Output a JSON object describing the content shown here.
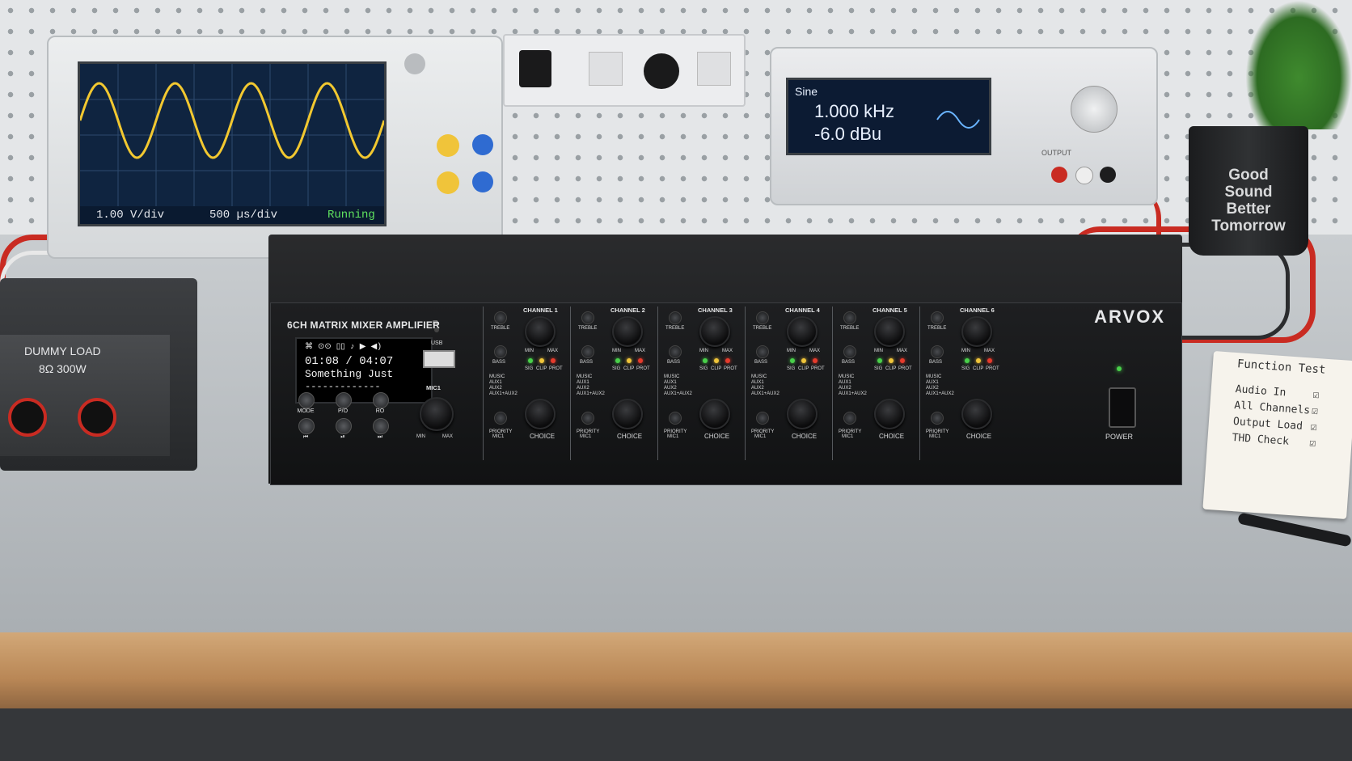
{
  "scope": {
    "volts_div": "1.00 V/div",
    "time_div": "500 µs/div",
    "status": "Running"
  },
  "generator": {
    "waveform": "Sine",
    "frequency": "1.000 kHz",
    "amplitude": "-6.0 dBu",
    "output_label": "OUTPUT"
  },
  "cup": {
    "line1": "Good",
    "line2": "Sound",
    "line3": "Better",
    "line4": "Tomorrow"
  },
  "dummy_load": {
    "title": "DUMMY LOAD",
    "spec": "8Ω 300W"
  },
  "amplifier": {
    "title": "6CH MATRIX MIXER AMPLIFIER",
    "brand": "ARVOX",
    "lcd_time": "01:08 / 04:07",
    "lcd_track": "Something Just",
    "lcd_bar": "-------------",
    "usb_label": "USB",
    "mic_label": "MIC1",
    "min_label": "MIN",
    "max_label": "MAX",
    "player_buttons": [
      "MODE",
      "P/O",
      "RO"
    ],
    "power_label": "POWER",
    "channels": [
      {
        "label": "CHANNEL 1"
      },
      {
        "label": "CHANNEL 2"
      },
      {
        "label": "CHANNEL 3"
      },
      {
        "label": "CHANNEL 4"
      },
      {
        "label": "CHANNEL 5"
      },
      {
        "label": "CHANNEL 6"
      }
    ],
    "treble": "TREBLE",
    "bass": "BASS",
    "sig": "SIG",
    "clip": "CLIP",
    "prot": "PROT",
    "priority": "PRIORITY",
    "priority2": "MIC1",
    "choice": "CHOICE",
    "sources": [
      "MUSIC",
      "AUX1",
      "AUX2",
      "AUX1+AUX2"
    ]
  },
  "notebook": {
    "title": "Function Test",
    "items": [
      "Audio In",
      "All Channels",
      "Output Load",
      "THD Check"
    ]
  },
  "colors": {
    "led_green": "#49d04a",
    "led_yellow": "#f0c53a",
    "led_red": "#e53b2c",
    "scope_trace": "#f2c830"
  }
}
